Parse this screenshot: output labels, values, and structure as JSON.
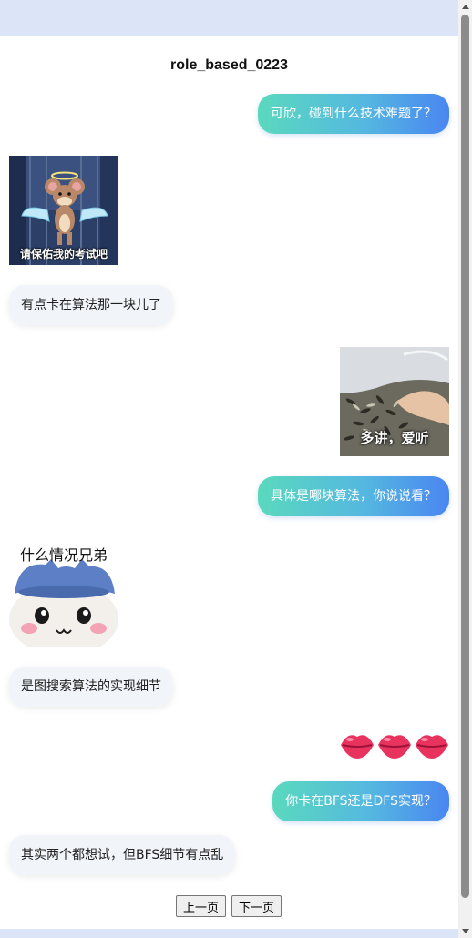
{
  "header": {
    "title": "role_based_0223"
  },
  "messages": [
    {
      "side": "right",
      "type": "text",
      "text": "可欣，碰到什么技术难题了？"
    },
    {
      "side": "left",
      "type": "sticker",
      "icon": "angel-mouse-sticker",
      "caption": "请保佑我的考试吧"
    },
    {
      "side": "left",
      "type": "text",
      "text": "有点卡在算法那一块儿了"
    },
    {
      "side": "right",
      "type": "sticker",
      "icon": "sunflower-seeds-sticker",
      "caption": "多讲，爱听"
    },
    {
      "side": "right",
      "type": "text",
      "text": "具体是哪块算法，你说说看？"
    },
    {
      "side": "left",
      "type": "sticker",
      "icon": "cute-hachiware-sticker",
      "caption": "什么情况兄弟"
    },
    {
      "side": "left",
      "type": "text",
      "text": "是图搜索算法的实现细节"
    },
    {
      "side": "right",
      "type": "emoji",
      "icon": "kiss-lips-icon",
      "text": "💋💋💋"
    },
    {
      "side": "right",
      "type": "text",
      "text": "你卡在BFS还是DFS实现？"
    },
    {
      "side": "left",
      "type": "text",
      "text": "其实两个都想试，但BFS细节有点乱"
    }
  ],
  "pagination": {
    "prev_label": "上一页",
    "next_label": "下一页"
  },
  "colors": {
    "bubble_gradient_start": "#5ad9bd",
    "bubble_gradient_end": "#4a86f1",
    "incoming_bubble": "#f1f4f8"
  }
}
